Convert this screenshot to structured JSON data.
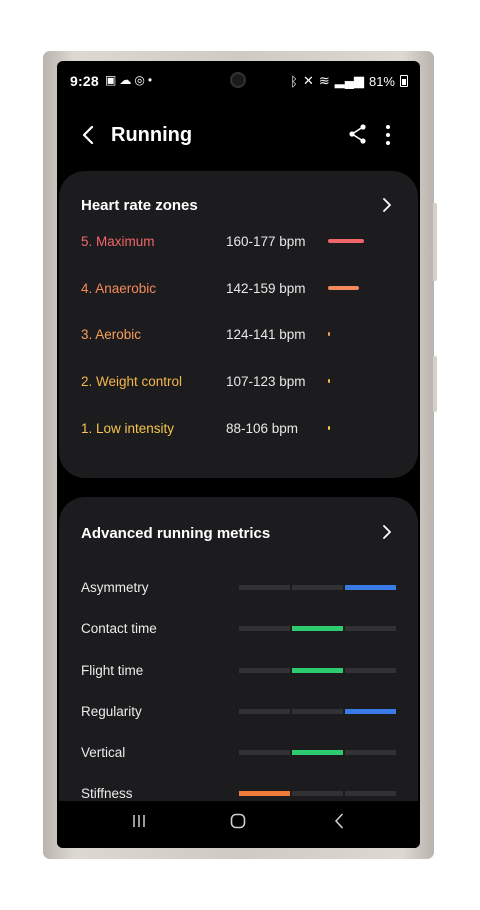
{
  "status_bar": {
    "time": "9:28",
    "battery": "81%"
  },
  "header": {
    "title": "Running"
  },
  "heart_rate_zones": {
    "title": "Heart rate zones",
    "zones": [
      {
        "label": "5. Maximum",
        "range": "160-177 bpm",
        "color": "#f0656a",
        "level": 0.2
      },
      {
        "label": "4. Anaerobic",
        "range": "142-159 bpm",
        "color": "#f48a5c",
        "level": 0.17
      },
      {
        "label": "3. Aerobic",
        "range": "124-141 bpm",
        "color": "#f5a05c",
        "level": 0.01
      },
      {
        "label": "2. Weight control",
        "range": "107-123 bpm",
        "color": "#f6b54c",
        "level": 0.01
      },
      {
        "label": "1. Low intensity",
        "range": "88-106 bpm",
        "color": "#f6c54a",
        "level": 0.005
      }
    ]
  },
  "advanced_metrics": {
    "title": "Advanced running metrics",
    "metrics": [
      {
        "label": "Asymmetry",
        "active_segment": 3,
        "color": "#3b7be8"
      },
      {
        "label": "Contact time",
        "active_segment": 2,
        "color": "#2ecc71"
      },
      {
        "label": "Flight time",
        "active_segment": 2,
        "color": "#2ecc71"
      },
      {
        "label": "Regularity",
        "active_segment": 3,
        "color": "#3b7be8"
      },
      {
        "label": "Vertical",
        "active_segment": 2,
        "color": "#2ecc71"
      },
      {
        "label": "Stiffness",
        "active_segment": 1,
        "color": "#f07a3c"
      }
    ]
  }
}
